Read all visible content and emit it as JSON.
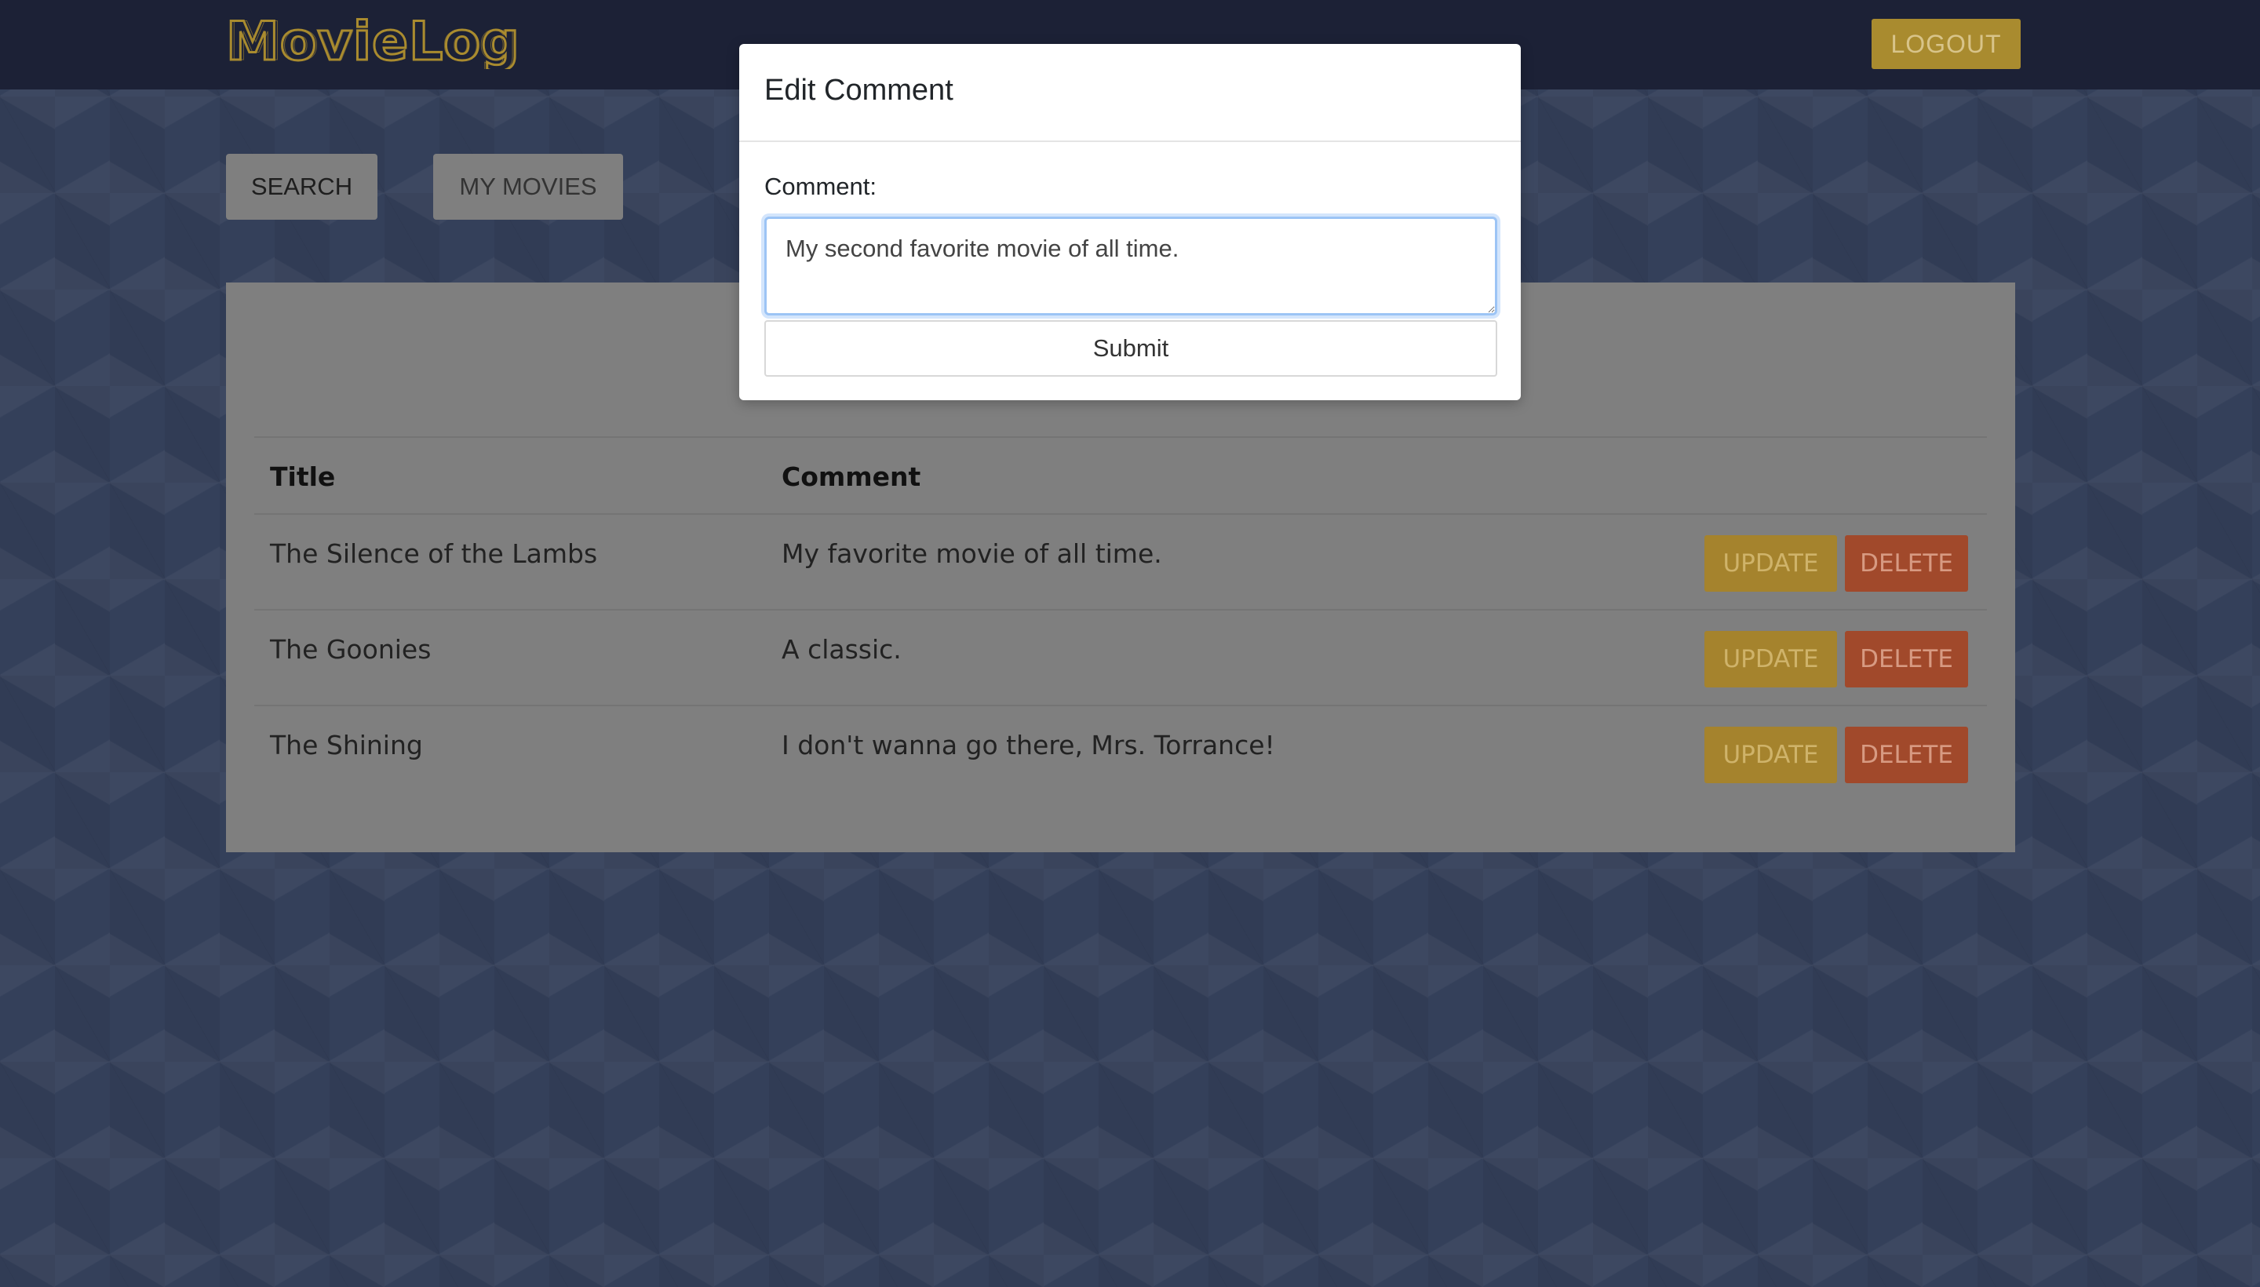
{
  "header": {
    "logo_text": "MovieLog",
    "logout_label": "LOGOUT"
  },
  "nav": {
    "search_label": "SEARCH",
    "my_movies_label": "MY MOVIES"
  },
  "table": {
    "columns": [
      "Title",
      "Comment"
    ],
    "rows": [
      {
        "title": "The Silence of the Lambs",
        "comment": "My favorite movie of all time.",
        "update_label": "UPDATE",
        "delete_label": "DELETE"
      },
      {
        "title": "The Goonies",
        "comment": "A classic.",
        "update_label": "UPDATE",
        "delete_label": "DELETE"
      },
      {
        "title": "The Shining",
        "comment": "I don't wanna go there, Mrs. Torrance!",
        "update_label": "UPDATE",
        "delete_label": "DELETE"
      }
    ]
  },
  "modal": {
    "title": "Edit Comment",
    "field_label": "Comment:",
    "comment_value": "My second favorite movie of all time.",
    "submit_label": "Submit"
  },
  "colors": {
    "navbar": "#1c2136",
    "accent_gold": "#a98b2f",
    "delete_orange": "#a1492b",
    "panel_gray": "#7f7f7f"
  }
}
